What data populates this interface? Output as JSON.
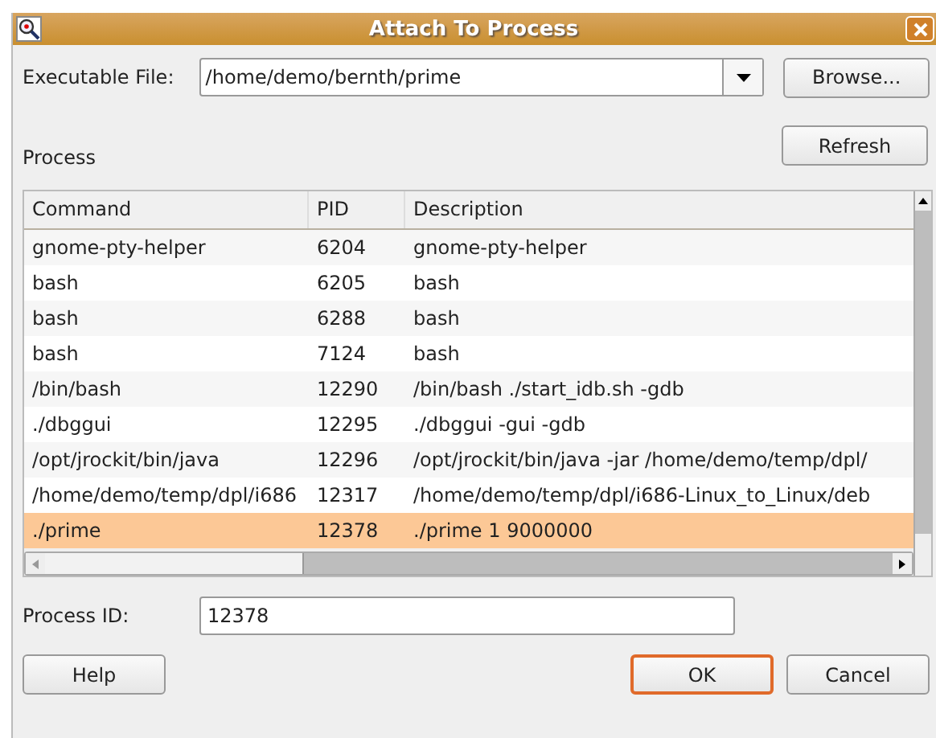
{
  "window": {
    "title": "Attach To Process"
  },
  "executable": {
    "label": "Executable File:",
    "value": "/home/demo/bernth/prime"
  },
  "buttons_top": [
    "Browse...",
    "Refresh"
  ],
  "process_label": "Process",
  "table": {
    "columns": [
      "Command",
      "PID",
      "Description"
    ],
    "rows": [
      {
        "command": "gnome-pty-helper",
        "pid": "6204",
        "description": "gnome-pty-helper",
        "selected": false
      },
      {
        "command": "bash",
        "pid": "6205",
        "description": "bash",
        "selected": false
      },
      {
        "command": "bash",
        "pid": "6288",
        "description": "bash",
        "selected": false
      },
      {
        "command": "bash",
        "pid": "7124",
        "description": "bash",
        "selected": false
      },
      {
        "command": "/bin/bash",
        "pid": "12290",
        "description": "/bin/bash ./start_idb.sh -gdb",
        "selected": false
      },
      {
        "command": "./dbggui",
        "pid": "12295",
        "description": "./dbggui -gui -gdb",
        "selected": false
      },
      {
        "command": "/opt/jrockit/bin/java",
        "pid": "12296",
        "description": "/opt/jrockit/bin/java -jar /home/demo/temp/dpl/",
        "selected": false
      },
      {
        "command": "/home/demo/temp/dpl/i686",
        "pid": "12317",
        "description": "/home/demo/temp/dpl/i686-Linux_to_Linux/deb",
        "selected": false
      },
      {
        "command": "./prime",
        "pid": "12378",
        "description": "./prime 1 9000000",
        "selected": true
      }
    ]
  },
  "process_id": {
    "label": "Process ID:",
    "value": "12378"
  },
  "buttons_bottom": [
    {
      "label": "Help",
      "kind": "plain"
    },
    {
      "label": "OK",
      "kind": "default"
    },
    {
      "label": "Cancel",
      "kind": "plain"
    }
  ]
}
